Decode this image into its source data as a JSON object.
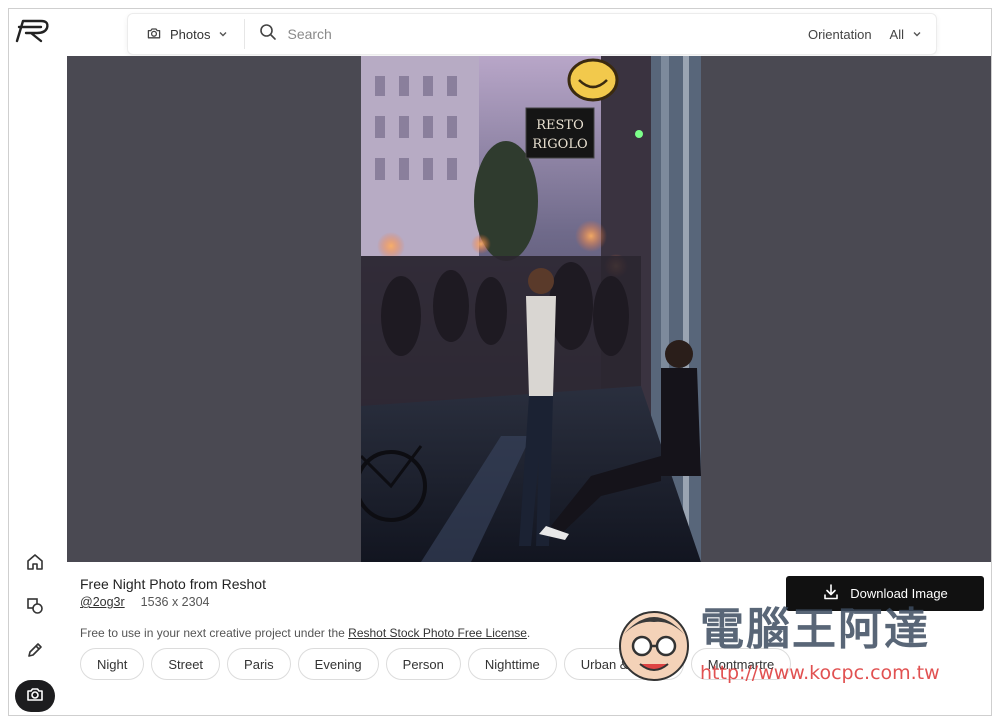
{
  "top_bar": {
    "media_type": "Photos",
    "search_placeholder": "Search",
    "orientation_label": "Orientation",
    "orientation_value": "All"
  },
  "sidebar": {
    "items": [
      {
        "name": "home-icon"
      },
      {
        "name": "shapes-icon"
      },
      {
        "name": "pencil-icon"
      },
      {
        "name": "camera-icon",
        "active": true
      }
    ]
  },
  "photo": {
    "title": "Free Night Photo from Reshot",
    "author": "@2og3r",
    "dimensions": "1536 x 2304",
    "license_prefix": "Free to use in your next creative project under the ",
    "license_link": "Reshot Stock Photo Free License",
    "license_suffix": ".",
    "sign_line1": "RESTO",
    "sign_line2": "RIGOLO"
  },
  "download": {
    "label": "Download Image"
  },
  "tags": [
    "Night",
    "Street",
    "Paris",
    "Evening",
    "Person",
    "Nighttime",
    "Urban & Street",
    "Montmartre"
  ],
  "watermark": {
    "text": "電腦王阿達",
    "url": "http://www.kocpc.com.tw"
  },
  "colors": {
    "stage_bg": "#4a4952",
    "button_bg": "#111111",
    "active_nav": "#1d1d1f"
  }
}
